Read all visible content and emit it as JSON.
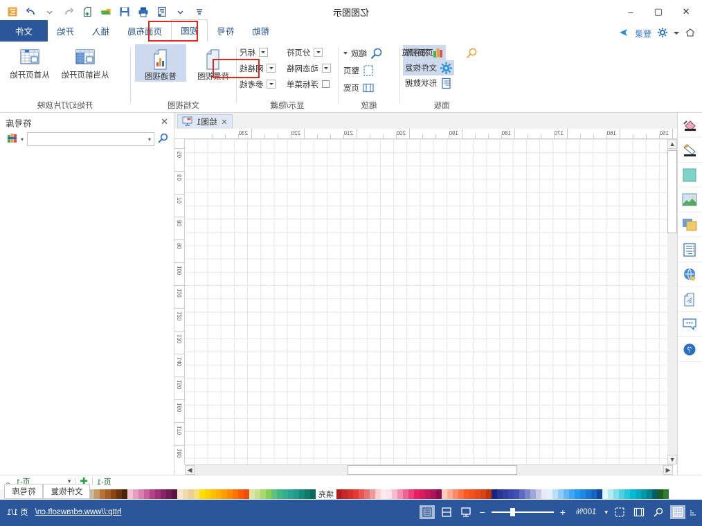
{
  "window": {
    "app_title": "亿图图示",
    "controls": {
      "close": "✕",
      "maximize": "▢",
      "minimize": "–"
    }
  },
  "account": {
    "home_icon": "home-icon",
    "gear_icon": "gear-icon",
    "login_label": "登录",
    "send_icon": "send-icon"
  },
  "quick_access": [
    {
      "name": "more-icon",
      "glyph": "▾"
    },
    {
      "name": "customize-qat-icon",
      "glyph": "▾"
    },
    {
      "name": "export-icon",
      "glyph": "🗒"
    },
    {
      "name": "print-icon",
      "glyph": "🖨"
    },
    {
      "name": "save-icon",
      "glyph": "💾"
    },
    {
      "name": "open-icon",
      "glyph": "📂"
    },
    {
      "name": "new-icon",
      "glyph": "➕"
    },
    {
      "name": "undo-icon",
      "glyph": "↶"
    },
    {
      "name": "undo-dropdown-icon",
      "glyph": "▾"
    },
    {
      "name": "redo-icon",
      "glyph": "↷"
    },
    {
      "name": "menu-icon",
      "glyph": "☰"
    }
  ],
  "ribbon": {
    "tabs": [
      {
        "label": "文件",
        "id": "file",
        "state": "file"
      },
      {
        "label": "开始",
        "id": "home",
        "state": "normal"
      },
      {
        "label": "插入",
        "id": "insert",
        "state": "normal"
      },
      {
        "label": "页面布局",
        "id": "page-layout",
        "state": "normal"
      },
      {
        "label": "视图",
        "id": "view",
        "state": "active"
      },
      {
        "label": "符号",
        "id": "symbols",
        "state": "normal"
      },
      {
        "label": "帮助",
        "id": "help",
        "state": "normal"
      }
    ],
    "active_tab_highlight_color": "#e8241f",
    "groups": [
      {
        "id": "slideshow",
        "label": "开始幻灯片放映",
        "buttons": [
          {
            "label": "从首页开始",
            "icon": "table-first-page-icon",
            "selected": false
          },
          {
            "label": "从当前页开始",
            "icon": "table-current-page-icon",
            "selected": false
          }
        ]
      },
      {
        "id": "doc-views",
        "label": "文档视图",
        "buttons": [
          {
            "label": "普通视图",
            "icon": "normal-view-icon",
            "selected": true
          },
          {
            "label": "背景视图",
            "icon": "background-view-icon",
            "selected": false
          }
        ]
      },
      {
        "id": "show-hide",
        "label": "显示/隐藏",
        "checks": [
          {
            "label": "标尺",
            "checked": true,
            "dropdown": true
          },
          {
            "label": "分页符",
            "checked": true,
            "dropdown": true
          },
          {
            "label": "网格线",
            "checked": true,
            "dropdown": true,
            "highlighted": true
          },
          {
            "label": "动态网格",
            "checked": true,
            "dropdown": true
          },
          {
            "label": "参考线",
            "checked": true,
            "dropdown": true
          },
          {
            "label": "浮标菜单",
            "checked": false,
            "dropdown": false
          }
        ]
      },
      {
        "id": "zoom",
        "label": "缩放",
        "items": [
          {
            "label": "缩放",
            "icon": "magnifier-icon",
            "dropdown": true
          },
          {
            "label": "整页",
            "icon": "whole-page-icon",
            "dropdown": false
          },
          {
            "label": "页宽",
            "icon": "page-width-icon",
            "dropdown": false
          }
        ]
      },
      {
        "id": "panels",
        "label": "面板",
        "items": [
          {
            "label": "符号库",
            "icon": "symbol-library-icon",
            "selected": true
          },
          {
            "label": "文件恢复",
            "icon": "file-recovery-icon",
            "selected": true
          },
          {
            "label": "形状数据",
            "icon": "shape-data-icon",
            "selected": false
          },
          {
            "label": "页面预览",
            "icon": "page-preview-icon",
            "selected": false
          }
        ]
      }
    ]
  },
  "left_tools": [
    {
      "name": "fill-icon",
      "title": "填充"
    },
    {
      "name": "line-icon",
      "title": "线条"
    },
    {
      "name": "shape-icon",
      "title": "形状"
    },
    {
      "name": "image-icon",
      "title": "图片"
    },
    {
      "name": "layers-icon",
      "title": "图层"
    },
    {
      "name": "form-icon",
      "title": "表单"
    },
    {
      "name": "hyperlink-icon",
      "title": "超链接"
    },
    {
      "name": "attachment-icon",
      "title": "附件"
    },
    {
      "name": "comment-icon",
      "title": "批注"
    },
    {
      "name": "help-icon",
      "title": "帮助"
    }
  ],
  "document": {
    "tab_label": "绘图1",
    "tab_icon": "drawing-icon",
    "close_glyph": "✕"
  },
  "canvas": {
    "h_ruler_ticks": [
      "150",
      "160",
      "170",
      "180",
      "190",
      "200",
      "210",
      "220",
      "230"
    ],
    "v_ruler_ticks": [
      "50",
      "60",
      "70",
      "80",
      "90",
      "100",
      "110",
      "120",
      "130",
      "140",
      "150",
      "160",
      "170",
      "180"
    ],
    "grid_visible": true,
    "unit": "mm"
  },
  "right_panel": {
    "title": "符号库",
    "close_glyph": "✕",
    "search_placeholder": "",
    "search_value": "",
    "search_icon": "search-icon",
    "library_icon": "library-icon",
    "dropdown_glyph": "▾"
  },
  "page_bar": {
    "fill_label": "填充",
    "page_label": "页-1",
    "add_page_label": "页-1",
    "add_glyph": "✚",
    "dropdown_glyph": "▾",
    "collapse_glyph": "︿"
  },
  "palette": {
    "row1": [
      "#f5f5f5",
      "#ececec",
      "#e0e0e0",
      "#d4d4d4",
      "#c5c5c5",
      "#b2b2b2",
      "#9e9e9e",
      "#8a8a8a",
      "#757575",
      "#5e5e5e",
      "#4a4a4a",
      "#333333",
      "#1a1a1a",
      "#000000",
      "#e8e6df",
      "#ded8c8",
      "#cdb89a",
      "#c49a6c",
      "#b87333",
      "#a65c2a",
      "#8b4513",
      "#6b3410",
      "#4a2208",
      "#f2c2d4",
      "#e79fc0",
      "#d87fae",
      "#c75f9b",
      "#b44289",
      "#9e2f78",
      "#872466",
      "#6f1b55",
      "#5a1345",
      "#f7e6c9",
      "#f1d9ae",
      "#ecd093",
      "#f5e17a",
      "#ffe000",
      "#ffd000",
      "#ffc000",
      "#ffb000",
      "#ff9e00",
      "#ff8a00",
      "#ff7400",
      "#ff5c00",
      "#ef4a12",
      "#d9e8a8",
      "#c7e08c",
      "#a8d86b",
      "#86cc55",
      "#5fc07a",
      "#3fb883",
      "#35ae8e",
      "#2aa395",
      "#1f9a8a",
      "#17897a",
      "#0f7a68",
      "#0a6a58"
    ],
    "row2": [
      "#b71c1c",
      "#c62828",
      "#d32f2f",
      "#e53935",
      "#ef5350",
      "#e57373",
      "#ef9a9a",
      "#ffcdd2",
      "#ffebee",
      "#fce4ec",
      "#f8bbd0",
      "#f48fb1",
      "#f06292",
      "#ec407a",
      "#e91e63",
      "#d81b60",
      "#c2185b",
      "#ad1457",
      "#880e4f",
      "#ffccbc",
      "#ffab91",
      "#ff8a65",
      "#ff7043",
      "#ff5722",
      "#f4511e",
      "#e64a19",
      "#d84315",
      "#bf360c",
      "#1a237e",
      "#283593",
      "#303f9f",
      "#3949ab",
      "#3f51b5",
      "#5c6bc0",
      "#7986cb",
      "#9fa8da",
      "#c5cae9",
      "#e8eaf6",
      "#e3f2fd",
      "#bbdefb",
      "#90caf9",
      "#64b5f6",
      "#42a5f5",
      "#2196f3",
      "#1e88e5",
      "#1976d2",
      "#1565c0",
      "#0d47a1",
      "#e0f7fa",
      "#b2ebf2",
      "#80deea",
      "#4dd0e1",
      "#26c6da",
      "#00bcd4",
      "#00acc1",
      "#0097a7",
      "#00838f",
      "#006064",
      "#1b5e20",
      "#2e7d32"
    ]
  },
  "panel_tabs": [
    {
      "label": "符号库",
      "active": true
    },
    {
      "label": "文件恢复",
      "active": false
    }
  ],
  "status_bar": {
    "view_buttons": [
      {
        "name": "grid-view-button",
        "glyph": "▦",
        "active": true
      },
      {
        "name": "zoom-select-button",
        "glyph": "⌕",
        "active": false
      },
      {
        "name": "fit-page-button",
        "glyph": "▥",
        "active": false
      },
      {
        "name": "select-area-button",
        "glyph": "▢",
        "active": false
      }
    ],
    "view_dropdown_glyph": "▾",
    "zoom_level": "100%",
    "zoom_in_glyph": "+",
    "zoom_out_glyph": "−",
    "layout_buttons": [
      {
        "name": "single-page-layout-button",
        "glyph": "⊟",
        "active": false
      },
      {
        "name": "split-layout-button",
        "glyph": "⊞",
        "active": false
      },
      {
        "name": "full-layout-button",
        "glyph": "▤",
        "active": true
      }
    ],
    "page_indicator": "页 1/1",
    "website_url": "http://www.edrawsoft.cn/"
  }
}
